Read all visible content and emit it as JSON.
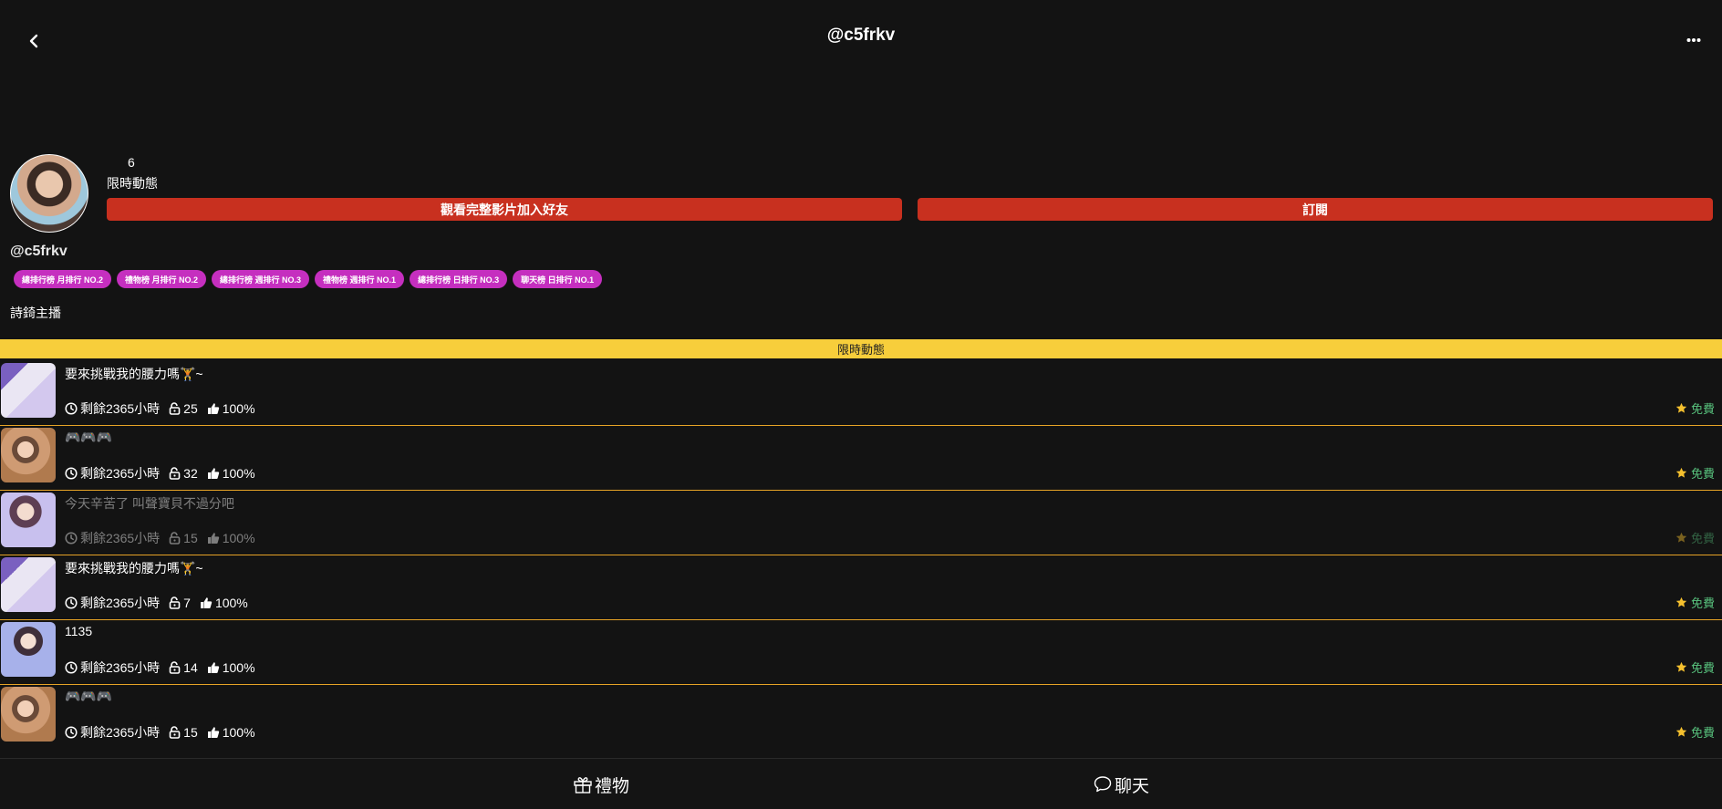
{
  "header": {
    "title": "@c5frkv",
    "back_icon": "chevron-left-icon",
    "more_icon": "more-dots-icon"
  },
  "profile": {
    "stat_count": "6",
    "stat_label": "限時動態",
    "buttons": {
      "friend_label": "觀看完整影片加入好友",
      "subscribe_label": "訂閱"
    },
    "username": "@c5frkv",
    "badges": [
      "總排行榜 月排行 NO.2",
      "禮物榜 月排行 NO.2",
      "總排行榜 週排行 NO.3",
      "禮物榜 週排行 NO.1",
      "總排行榜 日排行 NO.3",
      "聊天榜 日排行 NO.1"
    ],
    "bio": "詩錡主播"
  },
  "section": {
    "title": "限時動態"
  },
  "stories": [
    {
      "title": "要來挑戰我的腰力嗎🏋️~",
      "remaining": "剩餘2365小時",
      "unlocks": "25",
      "likes": "100%",
      "price": "免費"
    },
    {
      "title": "🎮🎮🎮",
      "remaining": "剩餘2365小時",
      "unlocks": "32",
      "likes": "100%",
      "price": "免費"
    },
    {
      "title": "今天辛苦了 叫聲寶貝不過分吧",
      "remaining": "剩餘2365小時",
      "unlocks": "15",
      "likes": "100%",
      "price": "免費"
    },
    {
      "title": "要來挑戰我的腰力嗎🏋️~",
      "remaining": "剩餘2365小時",
      "unlocks": "7",
      "likes": "100%",
      "price": "免費"
    },
    {
      "title": "1135",
      "remaining": "剩餘2365小時",
      "unlocks": "14",
      "likes": "100%",
      "price": "免費"
    },
    {
      "title": "🎮🎮🎮",
      "remaining": "剩餘2365小時",
      "unlocks": "15",
      "likes": "100%",
      "price": "免費"
    }
  ],
  "bottom_bar": {
    "gift_label": "禮物",
    "chat_label": "聊天"
  },
  "colors": {
    "background": "#131313",
    "accent_red": "#c8301f",
    "badge_magenta": "#c52fbf",
    "section_yellow": "#f7ce3b",
    "divider_orange": "#e6a326",
    "free_green": "#58c27d",
    "star_yellow": "#f5c02e"
  }
}
